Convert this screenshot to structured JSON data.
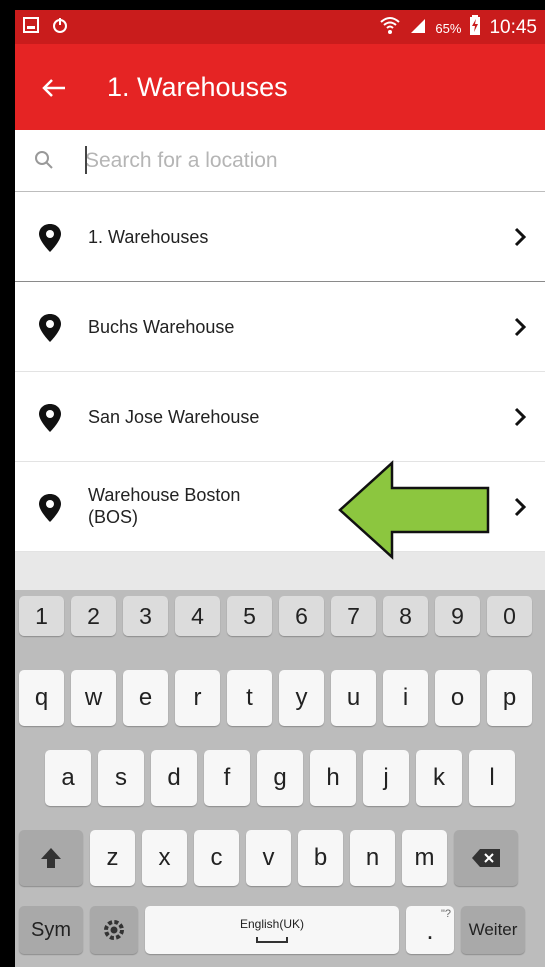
{
  "status_bar": {
    "battery_percent": "65%",
    "time": "10:45"
  },
  "app_bar": {
    "title": "1. Warehouses"
  },
  "search": {
    "placeholder": "Search for a location",
    "value": ""
  },
  "locations": [
    {
      "label": "1. Warehouses"
    },
    {
      "label": "Buchs Warehouse"
    },
    {
      "label": "San Jose Warehouse"
    },
    {
      "label": "Warehouse Boston (BOS)",
      "line1": "Warehouse Boston",
      "line2": "(BOS)"
    }
  ],
  "annotation": {
    "arrow_color": "#8cc63f",
    "points_to": "Warehouse Boston (BOS)"
  },
  "keyboard": {
    "numbers": [
      "1",
      "2",
      "3",
      "4",
      "5",
      "6",
      "7",
      "8",
      "9",
      "0"
    ],
    "row1": [
      "q",
      "w",
      "e",
      "r",
      "t",
      "y",
      "u",
      "i",
      "o",
      "p"
    ],
    "row2": [
      "a",
      "s",
      "d",
      "f",
      "g",
      "h",
      "j",
      "k",
      "l"
    ],
    "row3": [
      "z",
      "x",
      "c",
      "v",
      "b",
      "n",
      "m"
    ],
    "sym_label": "Sym",
    "space_label": "English(UK)",
    "punct_label": ".",
    "punct_hint": "\"?",
    "enter_label": "Weiter"
  },
  "colors": {
    "app_bar": "#e52424",
    "status_bar": "#c91c1c",
    "keyboard_bg": "#bcbcbc"
  }
}
